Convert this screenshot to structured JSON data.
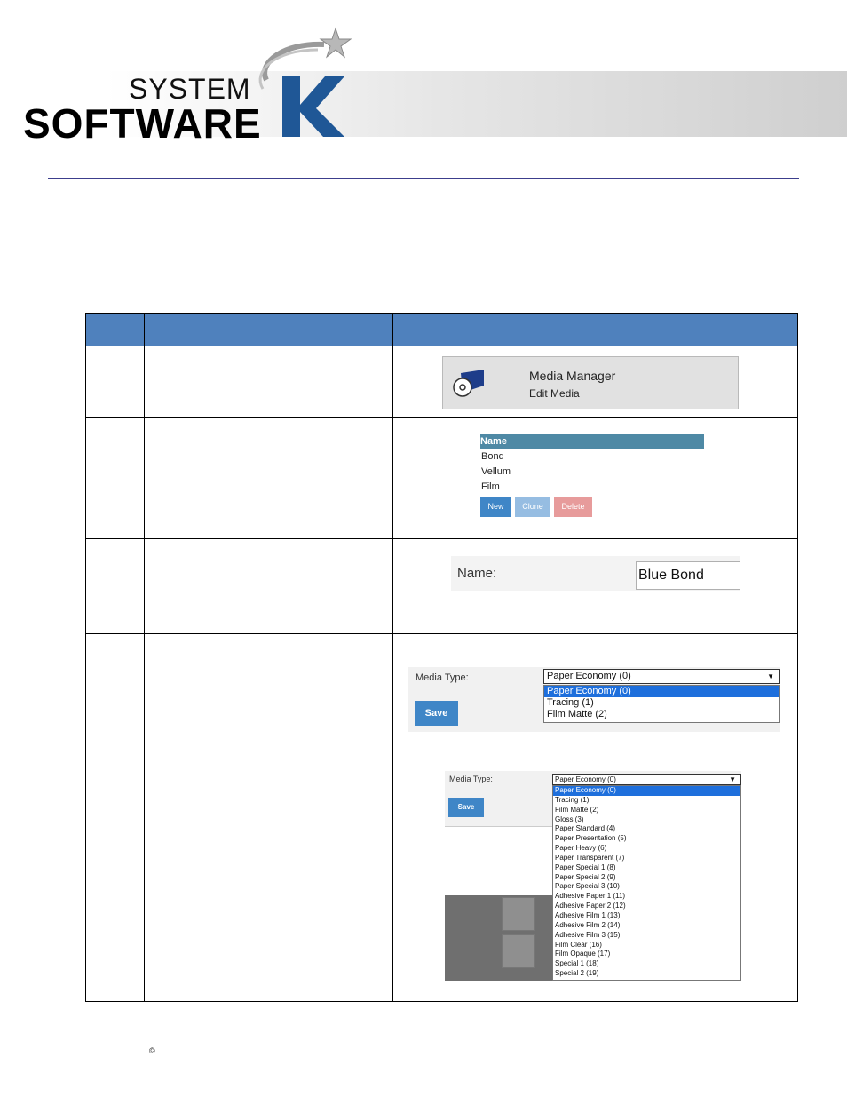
{
  "header": {
    "logo_system": "SYSTEM",
    "logo_software": "SOFTWARE",
    "logo_k": "K"
  },
  "row1": {
    "tile_title": "Media Manager",
    "tile_subtitle": "Edit Media"
  },
  "row2": {
    "list_header": "Name",
    "items": [
      "Bond",
      "Vellum",
      "Film"
    ],
    "buttons": {
      "new": "New",
      "clone": "Clone",
      "delete": "Delete"
    }
  },
  "row3": {
    "name_label": "Name:",
    "name_value": "Blue Bond"
  },
  "row4_large": {
    "label": "Media Type:",
    "selected": "Paper Economy (0)",
    "options": [
      "Paper Economy (0)",
      "Tracing (1)",
      "Film Matte (2)"
    ],
    "save_label": "Save"
  },
  "row4_small": {
    "label": "Media Type:",
    "selected": "Paper Economy (0)",
    "options": [
      "Paper Economy (0)",
      "Tracing (1)",
      "Film Matte (2)",
      "Gloss (3)",
      "Paper Standard (4)",
      "Paper Presentation (5)",
      "Paper Heavy (6)",
      "Paper Transparent (7)",
      "Paper Special 1 (8)",
      "Paper Special 2 (9)",
      "Paper Special 3 (10)",
      "Adhesive Paper 1 (11)",
      "Adhesive Paper 2 (12)",
      "Adhesive Film 1 (13)",
      "Adhesive Film 2 (14)",
      "Adhesive Film 3 (15)",
      "Film Clear (16)",
      "Film Opaque (17)",
      "Special 1 (18)",
      "Special 2 (19)"
    ],
    "save_label": "Save"
  },
  "footer": {
    "copyright": "©"
  },
  "colors": {
    "table_header": "#4f81bd",
    "rule": "#3c3e8c",
    "button_blue": "#3f86c7",
    "selected_option": "#1e6fdc"
  }
}
